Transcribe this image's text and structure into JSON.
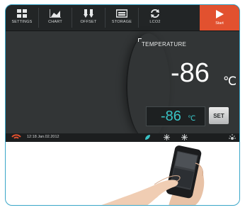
{
  "toolbar": {
    "items": [
      {
        "label": "SETTINGS",
        "icon": "grid-icon"
      },
      {
        "label": "CHART",
        "icon": "chart-icon"
      },
      {
        "label": "OFFSET",
        "icon": "offset-icon"
      },
      {
        "label": "STORAGE",
        "icon": "storage-icon"
      },
      {
        "label": "LCO2",
        "icon": "refresh-icon"
      }
    ],
    "start_label": "Start"
  },
  "readout": {
    "label": "TEMPERATURE",
    "value": "-86",
    "unit": "℃"
  },
  "setpoint": {
    "value": "-86",
    "unit": "℃",
    "set_label": "SET"
  },
  "status": {
    "datetime": "12:18 Jan.02.2012"
  },
  "colors": {
    "accent_start": "#e2512f",
    "setpoint_text": "#39c3c6",
    "device_border": "#3aa6c8"
  }
}
